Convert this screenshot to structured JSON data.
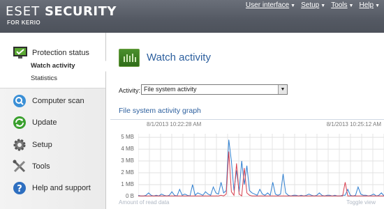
{
  "app": {
    "brand_eset": "ESET",
    "brand_security": "SECURITY",
    "brand_sub": "FOR KERIO"
  },
  "topmenu": [
    {
      "label": "User interface"
    },
    {
      "label": "Setup"
    },
    {
      "label": "Tools"
    },
    {
      "label": "Help"
    }
  ],
  "sidebar": {
    "protection_status": "Protection status",
    "watch_activity": "Watch activity",
    "statistics": "Statistics",
    "computer_scan": "Computer scan",
    "update": "Update",
    "setup": "Setup",
    "tools": "Tools",
    "help": "Help and support"
  },
  "main": {
    "title": "Watch activity",
    "activity_label": "Activity:",
    "activity_value": "File system activity",
    "graph_title": "File system activity graph",
    "date_left": "8/1/2013 10:22:28 AM",
    "date_right": "8/1/2013 10:25:12 AM",
    "legend_text": "Amount of read data",
    "toggle_view": "Toggle view"
  },
  "colors": {
    "accent": "#2c5f9e",
    "read_series": "#2f7fd0",
    "write_series": "#d8404f",
    "header": "#545963"
  },
  "chart_data": {
    "type": "line",
    "x_start": "8/1/2013 10:22:28 AM",
    "x_end": "8/1/2013 10:25:12 AM",
    "yticks": [
      "5 MB",
      "4 MB",
      "3 MB",
      "2 MB",
      "1 MB",
      "0 B"
    ],
    "ylim": [
      0,
      5.3
    ],
    "y_unit": "MB",
    "grid": true,
    "series": [
      {
        "values": [
          0.1,
          0.05,
          0.05,
          0.1,
          0.3,
          0.1,
          0.05,
          0.1,
          0.05,
          0.2,
          0.1,
          0.05,
          0.1,
          0.4,
          0.1,
          0.05,
          0.6,
          0.1,
          0.2,
          0.1,
          0.05,
          1.0,
          0.1,
          0.3,
          0.2,
          0.1,
          0.4,
          0.2,
          0.1,
          0.8,
          0.3,
          0.2,
          1.2,
          0.3,
          0.5,
          4.8,
          3.0,
          0.5,
          2.2,
          0.4,
          3.0,
          1.0,
          2.6,
          0.5,
          0.3,
          0.2,
          0.1,
          0.6,
          0.2,
          0.1,
          0.3,
          0.1,
          1.2,
          0.2,
          0.1,
          0.2,
          1.9,
          0.3,
          0.1,
          0.05,
          0.1,
          0.1,
          0.05,
          0.1,
          0.05,
          0.1,
          0.2,
          0.1,
          0.05,
          0.1,
          0.3,
          0.1,
          0.05,
          0.1,
          0.1,
          0.05,
          0.1,
          0.05,
          0.05,
          0.1,
          0.1,
          0.6,
          0.1,
          0.05,
          0.1,
          0.8,
          0.2,
          0.1,
          0.1,
          0.05,
          0.1,
          0.2,
          0.05,
          0.1,
          0.3,
          0.05
        ]
      },
      {
        "values": [
          0.05,
          0.05,
          0.05,
          0.05,
          0.05,
          0.05,
          0.05,
          0.05,
          0.05,
          0.05,
          0.05,
          0.05,
          0.05,
          0.05,
          0.05,
          0.05,
          0.05,
          0.05,
          0.05,
          0.05,
          0.05,
          0.05,
          0.05,
          0.05,
          0.05,
          0.05,
          0.05,
          0.05,
          0.05,
          0.05,
          0.05,
          0.05,
          0.1,
          0.05,
          0.2,
          3.8,
          0.4,
          0.1,
          2.8,
          0.2,
          0.05,
          2.4,
          0.3,
          0.1,
          0.05,
          0.05,
          0.05,
          0.05,
          0.05,
          0.05,
          0.05,
          0.05,
          0.05,
          0.05,
          0.05,
          0.05,
          0.05,
          0.05,
          0.05,
          0.05,
          0.05,
          0.05,
          0.05,
          0.05,
          0.05,
          0.05,
          0.05,
          0.05,
          0.05,
          0.05,
          0.05,
          0.05,
          0.05,
          0.05,
          0.05,
          0.05,
          0.05,
          0.05,
          0.05,
          0.05,
          1.2,
          0.05,
          0.05,
          0.05,
          0.05,
          0.05,
          0.05,
          0.05,
          0.05,
          0.05,
          0.05,
          0.05,
          0.05,
          0.05,
          0.05,
          0.05
        ]
      }
    ]
  }
}
